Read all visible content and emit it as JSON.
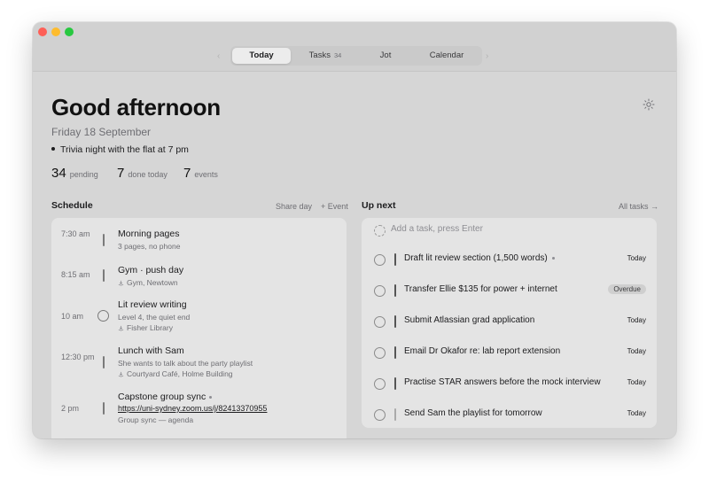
{
  "window": {
    "tabs": [
      {
        "label": "Today"
      },
      {
        "label": "Tasks",
        "badge": "34"
      },
      {
        "label": "Jot"
      },
      {
        "label": "Calendar"
      }
    ]
  },
  "header": {
    "greeting": "Good afternoon",
    "date": "Friday 18 September",
    "note": "Trivia night with the flat at 7 pm"
  },
  "stats": {
    "pending": {
      "value": "34",
      "label": "pending"
    },
    "done": {
      "value": "7",
      "label": "done today"
    },
    "events": {
      "value": "7",
      "label": "events"
    }
  },
  "schedule": {
    "title": "Schedule",
    "share_label": "Share day",
    "add_label": "+ Event",
    "events": [
      {
        "time": "7:30 am",
        "title": "Morning pages",
        "sub": "3 pages, no phone",
        "loc": ""
      },
      {
        "time": "8:15 am",
        "title": "Gym · push day",
        "sub": "",
        "loc": "Gym, Newtown"
      },
      {
        "time": "10 am",
        "title": "Lit review writing",
        "sub": "Level 4, the quiet end",
        "loc": "Fisher Library"
      },
      {
        "time": "12:30 pm",
        "title": "Lunch with Sam",
        "sub": "She wants to talk about the party playlist",
        "loc": "Courtyard Café, Holme Building"
      },
      {
        "time": "2 pm",
        "title": "Capstone group sync",
        "link": "https://uni-sydney.zoom.us/j/82413370955",
        "sub": "Group sync — agenda"
      }
    ]
  },
  "upnext": {
    "title": "Up next",
    "all_label": "All tasks →",
    "add_placeholder": "Add a task, press Enter",
    "tasks": [
      {
        "title": "Draft lit review section (1,500 words)",
        "due": "Today"
      },
      {
        "title": "Transfer Ellie $135 for power + internet",
        "due": "Overdue"
      },
      {
        "title": "Submit Atlassian grad application",
        "due": "Today"
      },
      {
        "title": "Email Dr Okafor re: lab report extension",
        "due": "Today"
      },
      {
        "title": "Practise STAR answers before the mock interview",
        "due": "Today"
      },
      {
        "title": "Send Sam the playlist for tomorrow",
        "due": "Today"
      }
    ]
  },
  "colors": {
    "window_bg": "#d6d6d6",
    "panel_bg": "#e4e4e4",
    "traffic_red": "#fe5f57",
    "traffic_yellow": "#febc2e",
    "traffic_green": "#28c840"
  },
  "icons": {
    "appearance": "sun-icon",
    "location": "pin-icon"
  }
}
